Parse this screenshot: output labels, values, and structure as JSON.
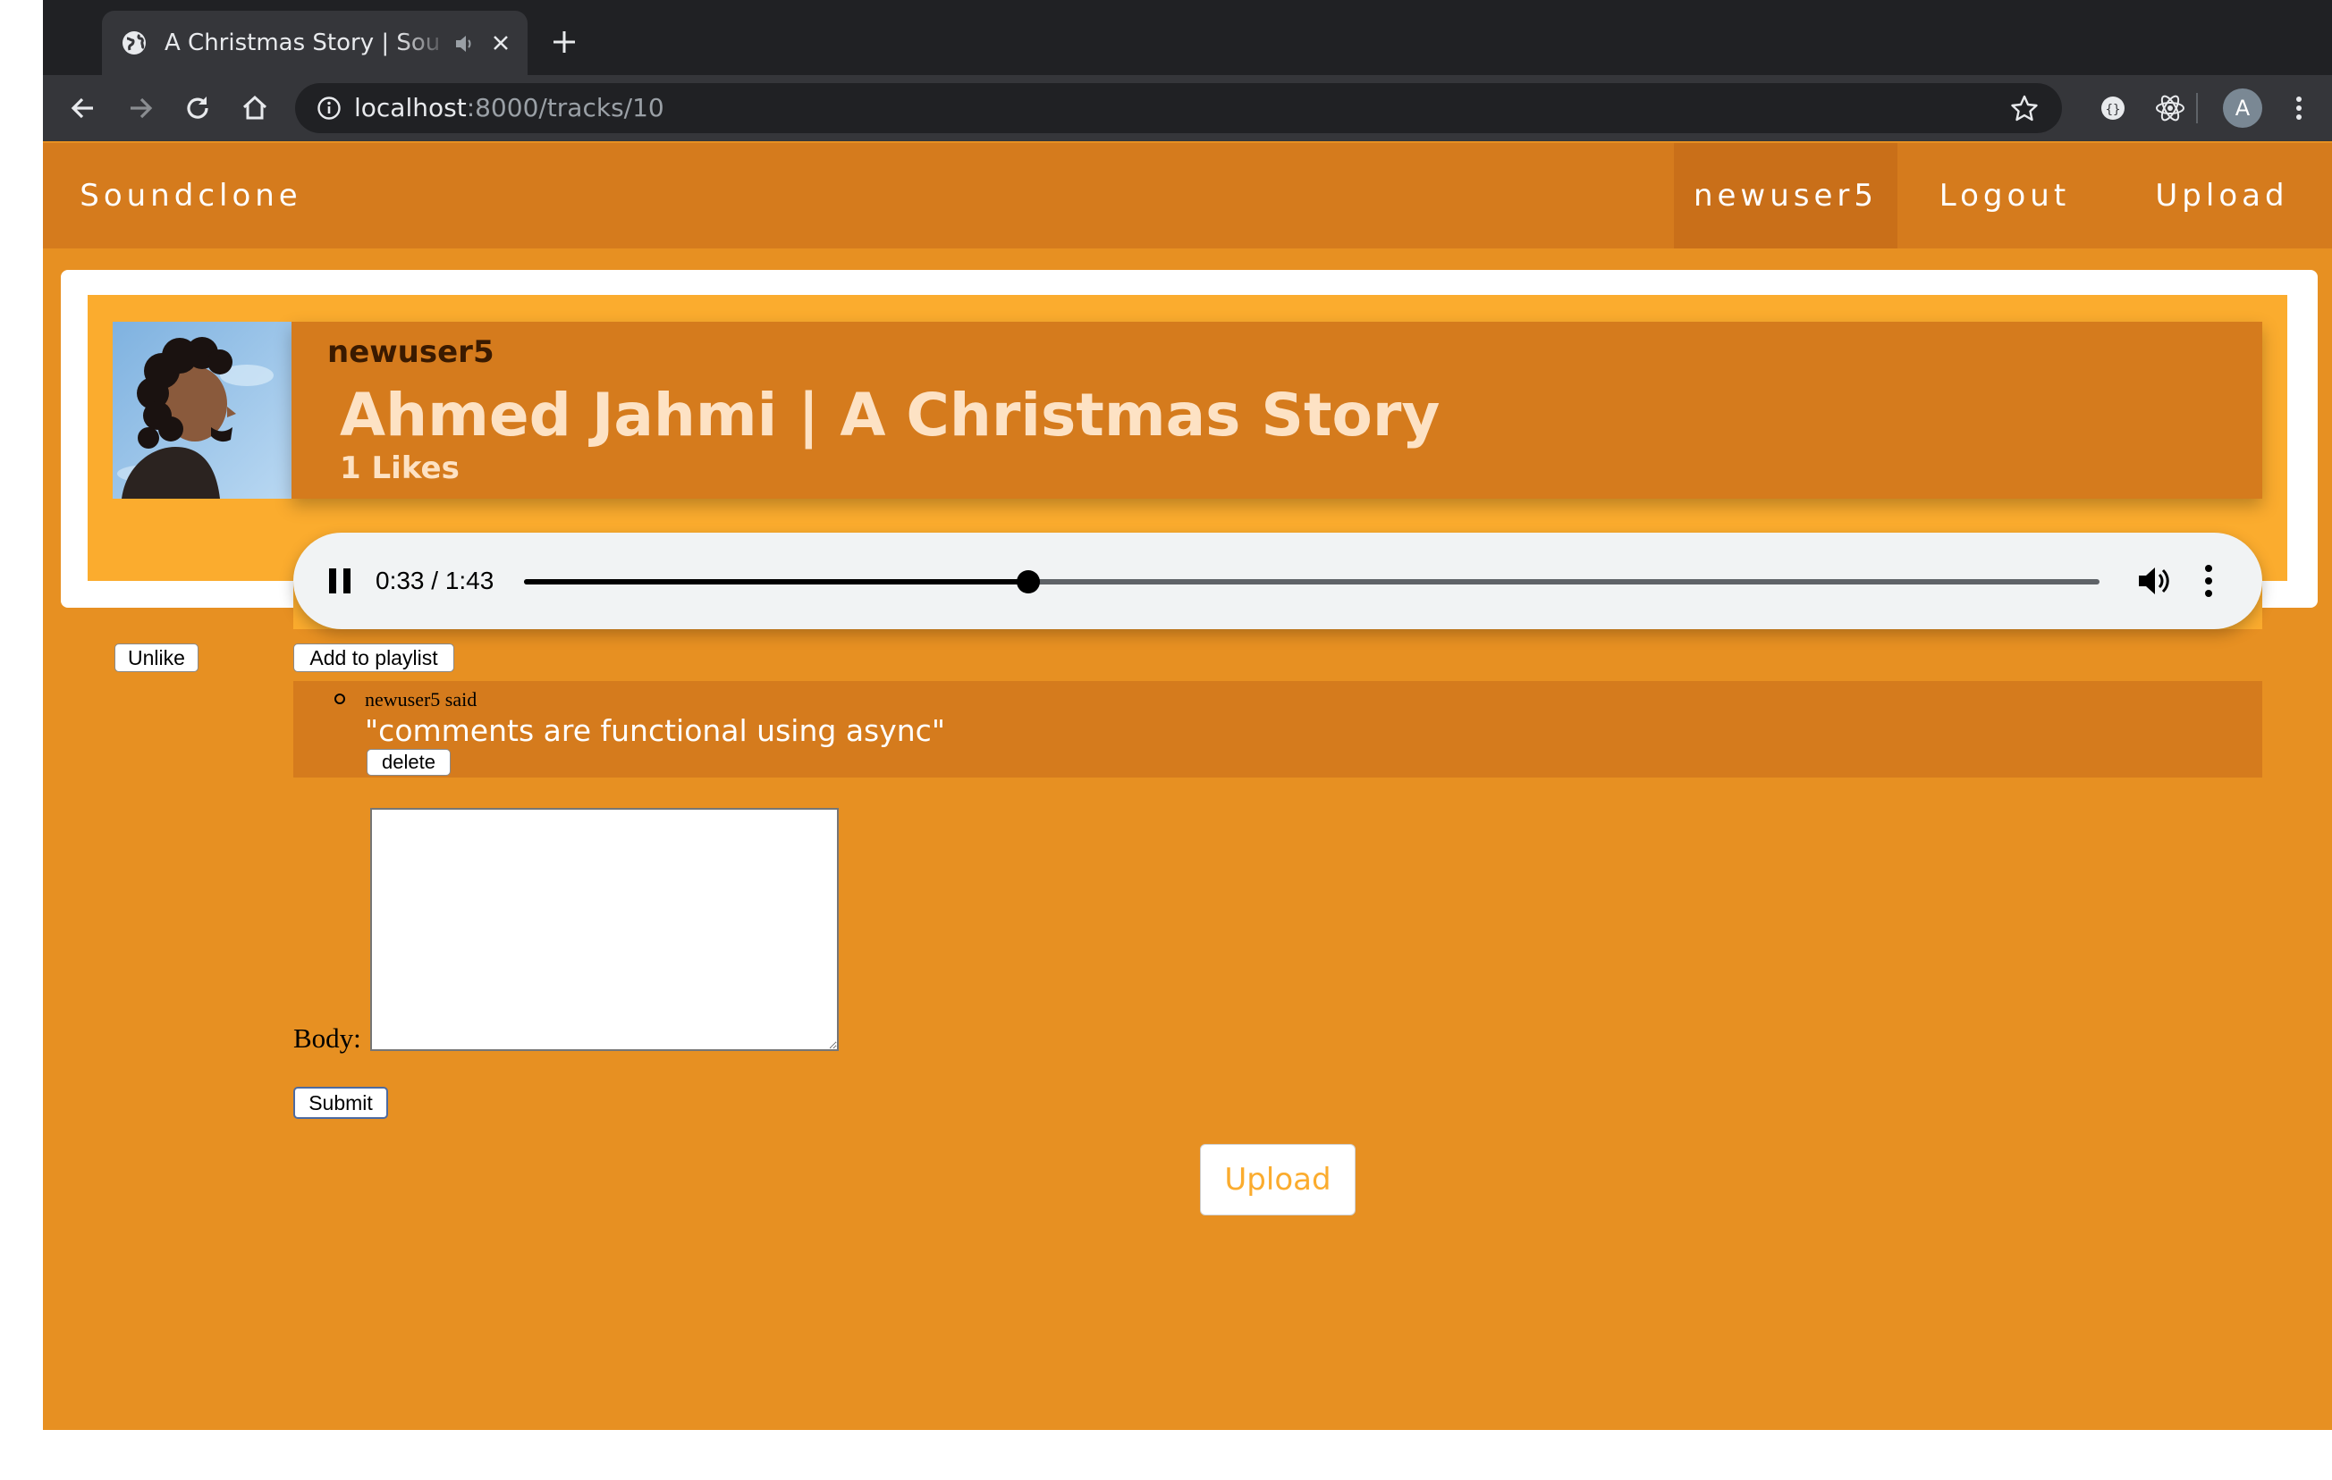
{
  "browser": {
    "tab_title": "A Christmas Story | Soundclone",
    "url_host": "localhost",
    "url_path": ":8000/tracks/10",
    "avatar_initial": "A"
  },
  "nav": {
    "brand": "Soundclone",
    "user": "newuser5",
    "logout": "Logout",
    "upload": "Upload"
  },
  "track": {
    "uploader": "newuser5",
    "title": "Ahmed Jahmi | A Christmas Story",
    "likes": "1 Likes",
    "unlike_label": "Unlike",
    "add_to_playlist_label": "Add to playlist"
  },
  "player": {
    "time": "0:33 / 1:43",
    "progress_fraction": 0.32
  },
  "comments": [
    {
      "meta": "newuser5 said",
      "body": "\"comments are functional using async\"",
      "delete_label": "delete"
    }
  ],
  "form": {
    "body_label": "Body:",
    "submit_label": "Submit"
  },
  "footer": {
    "upload_label": "Upload"
  },
  "colors": {
    "page_bg": "#e79022",
    "nav_bg": "#d57b1d",
    "card_inner": "#fbac2e"
  },
  "icons": [
    "globe-icon",
    "speaker-icon",
    "close-icon",
    "plus-icon",
    "back-icon",
    "forward-icon",
    "reload-icon",
    "home-icon",
    "info-icon",
    "star-icon",
    "extension-icon",
    "react-icon",
    "pause-icon",
    "volume-icon",
    "more-vert-icon",
    "menu-icon"
  ]
}
